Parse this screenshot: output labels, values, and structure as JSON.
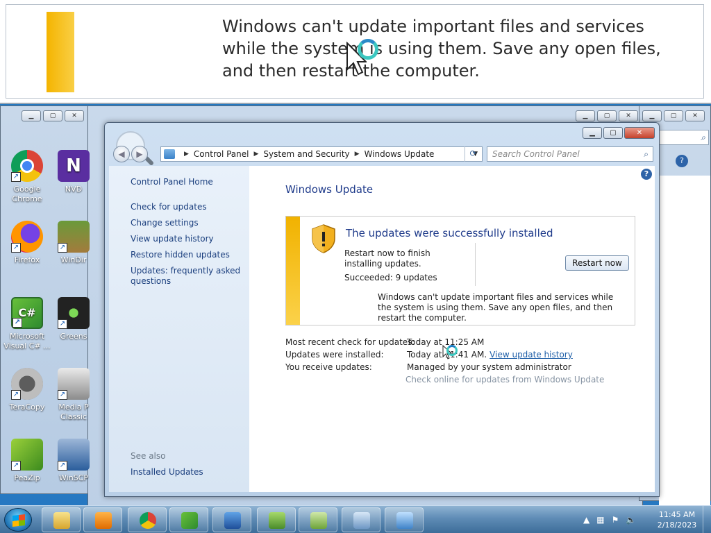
{
  "zoom": {
    "text": "Windows can't update important files and services while the system is using them. Save any open files, and then restart the computer."
  },
  "desktop_icons": [
    {
      "label": "Google Chrome",
      "icon": "chrome-icon"
    },
    {
      "label": "Firefox",
      "icon": "firefox-icon"
    },
    {
      "label": "Microsoft Visual C# ...",
      "icon": "visual-csharp-icon"
    },
    {
      "label": "TeraCopy",
      "icon": "teracopy-icon"
    },
    {
      "label": "PeaZip",
      "icon": "peazip-icon"
    },
    {
      "label": "NVD",
      "icon": "nvd-icon"
    },
    {
      "label": "WinDir",
      "icon": "windirstat-icon"
    },
    {
      "label": "Greens",
      "icon": "greenshot-icon"
    },
    {
      "label": "Media P Classic",
      "icon": "media-player-classic-icon"
    },
    {
      "label": "WinSCP",
      "icon": "winscp-icon"
    }
  ],
  "address": {
    "crumbs": [
      "Control Panel",
      "System and Security",
      "Windows Update"
    ]
  },
  "search": {
    "placeholder": "Search Control Panel"
  },
  "sidebar": {
    "home": "Control Panel Home",
    "links": [
      "Check for updates",
      "Change settings",
      "View update history",
      "Restore hidden updates",
      "Updates: frequently asked questions"
    ],
    "see_also": "See also",
    "installed_updates": "Installed Updates"
  },
  "main": {
    "title": "Windows Update",
    "notice": {
      "title": "The updates were successfully installed",
      "message": "Restart now to finish installing updates.",
      "succeeded": "Succeeded: 9 updates",
      "restart_button": "Restart now",
      "warning": "Windows can't update important files and services while the system is using them. Save any open files, and then restart the computer."
    },
    "info": {
      "recent_check_label": "Most recent check for updates:",
      "recent_check_value": "Today at 11:25 AM",
      "installed_label": "Updates were installed:",
      "installed_value": "Today at 11:41 AM.",
      "view_history": "View update history",
      "receive_label": "You receive updates:",
      "receive_value": "Managed by your system administrator",
      "check_online": "Check online for updates from Windows Update"
    }
  },
  "tray": {
    "time": "11:45 AM",
    "date": "2/18/2023"
  },
  "colors": {
    "accent": "#1e3a8a",
    "link": "#1b3f7e",
    "stripe": "#f4b400"
  }
}
